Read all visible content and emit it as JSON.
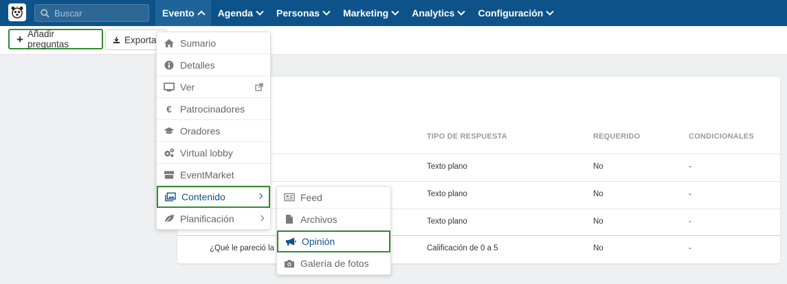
{
  "nav": {
    "search_placeholder": "Buscar",
    "items": [
      {
        "label": "Evento",
        "active": true
      },
      {
        "label": "Agenda"
      },
      {
        "label": "Personas"
      },
      {
        "label": "Marketing"
      },
      {
        "label": "Analytics"
      },
      {
        "label": "Configuración"
      }
    ]
  },
  "toolbar": {
    "add_label": "Añadir preguntas",
    "export_label": "Exportar"
  },
  "table": {
    "headers": [
      "TIPO DE RESPUESTA",
      "REQUERIDO",
      "CONDICIONALES"
    ],
    "rows": [
      {
        "question": "",
        "type": "Texto plano",
        "required": "No",
        "conditional": "-"
      },
      {
        "question": "",
        "type": "Texto plano",
        "required": "No",
        "conditional": "-"
      },
      {
        "question": "",
        "type": "Texto plano",
        "required": "No",
        "conditional": "-"
      },
      {
        "question": "¿Qué le pareció la pe",
        "type": "Calificación de 0 a 5",
        "required": "No",
        "conditional": "-"
      }
    ]
  },
  "menu_main": {
    "items": [
      {
        "label": "Sumario",
        "icon": "home-icon"
      },
      {
        "label": "Detalles",
        "icon": "info-icon"
      },
      {
        "label": "Ver",
        "icon": "monitor-icon"
      },
      {
        "label": "Patrocinadores",
        "icon": "euro-icon"
      },
      {
        "label": "Oradores",
        "icon": "graduation-cap-icon"
      },
      {
        "label": "Virtual lobby",
        "icon": "gears-icon"
      },
      {
        "label": "EventMarket",
        "icon": "store-icon"
      },
      {
        "label": "Contenido",
        "icon": "images-icon"
      },
      {
        "label": "Planificación",
        "icon": "leaf-icon"
      }
    ]
  },
  "menu_sub": {
    "items": [
      {
        "label": "Feed",
        "icon": "newspaper-icon"
      },
      {
        "label": "Archivos",
        "icon": "file-icon"
      },
      {
        "label": "Opinión",
        "icon": "megaphone-icon"
      },
      {
        "label": "Galería de fotos",
        "icon": "camera-icon"
      }
    ]
  },
  "colors": {
    "nav_bg": "#0d5389",
    "highlight_border": "#2e8b2e",
    "link": "#0d5389"
  }
}
